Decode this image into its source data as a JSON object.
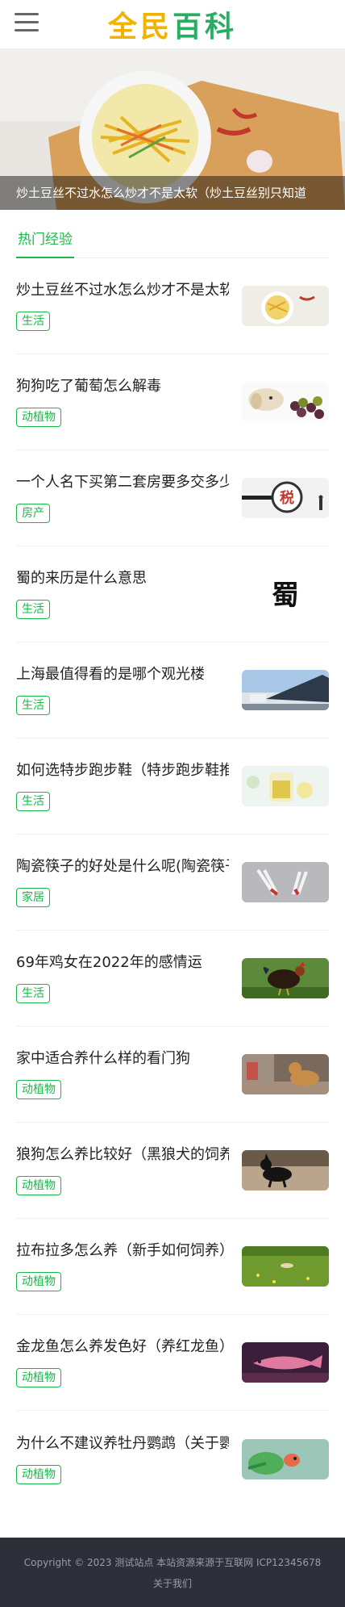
{
  "header": {
    "logo_part1": "全民",
    "logo_part2": "百科"
  },
  "banner": {
    "caption": "炒土豆丝不过水怎么炒才不是太软（炒土豆丝别只知道"
  },
  "tabs": [
    {
      "label": "热门经验"
    }
  ],
  "articles": [
    {
      "title": "炒土豆丝不过水怎么炒才不是太软",
      "tag": "生活"
    },
    {
      "title": "狗狗吃了葡萄怎么解毒",
      "tag": "动植物"
    },
    {
      "title": "一个人名下买第二套房要多交多少税",
      "tag": "房产"
    },
    {
      "title": "蜀的来历是什么意思",
      "tag": "生活"
    },
    {
      "title": "上海最值得看的是哪个观光楼",
      "tag": "生活"
    },
    {
      "title": "如何选特步跑步鞋（特步跑步鞋推荐）",
      "tag": "生活"
    },
    {
      "title": "陶瓷筷子的好处是什么呢(陶瓷筷子)",
      "tag": "家居"
    },
    {
      "title": "69年鸡女在2022年的感情运",
      "tag": "生活"
    },
    {
      "title": "家中适合养什么样的看门狗",
      "tag": "动植物"
    },
    {
      "title": "狼狗怎么养比较好（黑狼犬的饲养）",
      "tag": "动植物"
    },
    {
      "title": "拉布拉多怎么养（新手如何饲养）",
      "tag": "动植物"
    },
    {
      "title": "金龙鱼怎么养发色好（养红龙鱼）",
      "tag": "动植物"
    },
    {
      "title": "为什么不建议养牡丹鹦鹉（关于鹦鹉）",
      "tag": "动植物"
    }
  ],
  "thumb_text": {
    "shu": "蜀",
    "tax": "税"
  },
  "footer": {
    "copyright": "Copyright © 2023 测试站点 本站资源来源于互联网 ICP12345678",
    "about": "关于我们"
  },
  "colors": {
    "accent": "#19b94a",
    "logo_yellow": "#f2b300",
    "logo_green": "#27ae60",
    "footer_bg": "#2e3039"
  }
}
